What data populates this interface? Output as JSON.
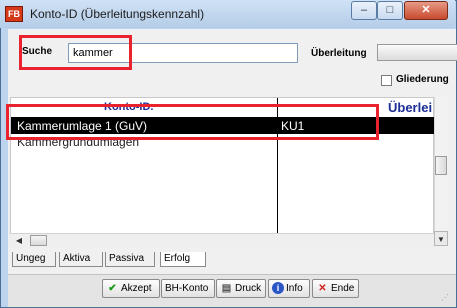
{
  "window": {
    "title": "Konto-ID (Überleitungskennzahl)",
    "app_icon_text": "FB"
  },
  "titlebar_buttons": {
    "minimize": "–",
    "maximize": "□",
    "close": "✕"
  },
  "search": {
    "label": "Suche",
    "value": "kammer"
  },
  "ueberleitung": {
    "label": "Überleitung",
    "gliederung_label": "Gliederung",
    "gliederung_checked": false
  },
  "grid": {
    "columns": [
      "Konto-ID.",
      "Überlei"
    ],
    "rows": [
      {
        "name": "Kammerumlage 1 (GuV)",
        "code": "KU1",
        "selected": true
      },
      {
        "name": "Kammergrundumlagen",
        "code": "",
        "selected": false
      }
    ]
  },
  "tabs": [
    "Ungeg",
    "Aktiva",
    "Passiva",
    "Erfolg"
  ],
  "active_tab": "Erfolg",
  "buttons": [
    "Akzept",
    "BH-Konto",
    "Druck",
    "Info",
    "Ende"
  ],
  "colors": {
    "highlight_red": "#e8232e",
    "header_blue": "#1b2d96",
    "selection": "#000000"
  }
}
